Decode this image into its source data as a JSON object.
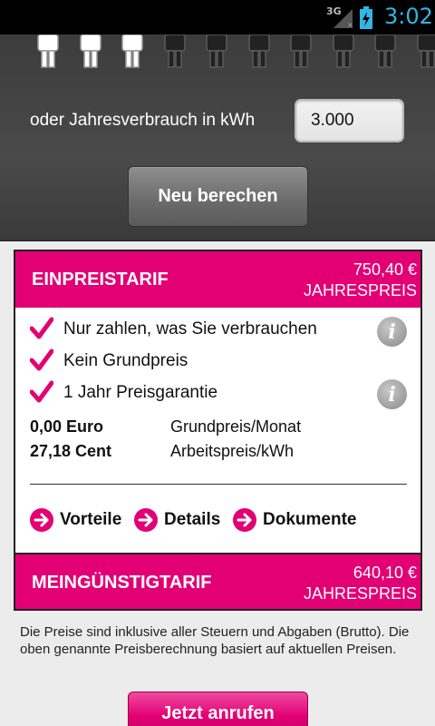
{
  "statusbar": {
    "network": "3G",
    "time": "3:02"
  },
  "household": {
    "persons_total": 10,
    "persons_selected": 3
  },
  "consumption": {
    "label": "oder Jahresverbrauch in kWh",
    "value": "3.000"
  },
  "recalculate_label": "Neu berechen",
  "tariffs": [
    {
      "name": "EINPREISTARIF",
      "price": "750,40 €",
      "price_caption": "JAHRESPREIS",
      "benefits": [
        {
          "text": "Nur zahlen, was Sie verbrauchen",
          "info": true
        },
        {
          "text": "Kein Grundpreis",
          "info": false
        },
        {
          "text": "1 Jahr Preisgarantie",
          "info": true
        }
      ],
      "prices": [
        {
          "value": "0,00 Euro",
          "label": "Grundpreis/Monat"
        },
        {
          "value": "27,18 Cent",
          "label": "Arbeitspreis/kWh"
        }
      ],
      "links": [
        "Vorteile",
        "Details",
        "Dokumente"
      ]
    },
    {
      "name": "MEINGÜNSTIGTARIF",
      "price": "640,10 €",
      "price_caption": "JAHRESPREIS"
    }
  ],
  "disclaimer": "Die Preise sind inklusive aller Steuern und Abgaben (Brutto). Die oben genannte Preisberechnung basiert auf aktuellen Preisen.",
  "call_button_label": "Jetzt anrufen",
  "colors": {
    "magenta": "#e20074",
    "dark_panel": "#404040",
    "info_grey": "#9a9a9a"
  },
  "icons": [
    "person-icon",
    "check-icon",
    "info-icon",
    "arrow-right-circle-icon",
    "signal-icon",
    "battery-charging-icon"
  ]
}
